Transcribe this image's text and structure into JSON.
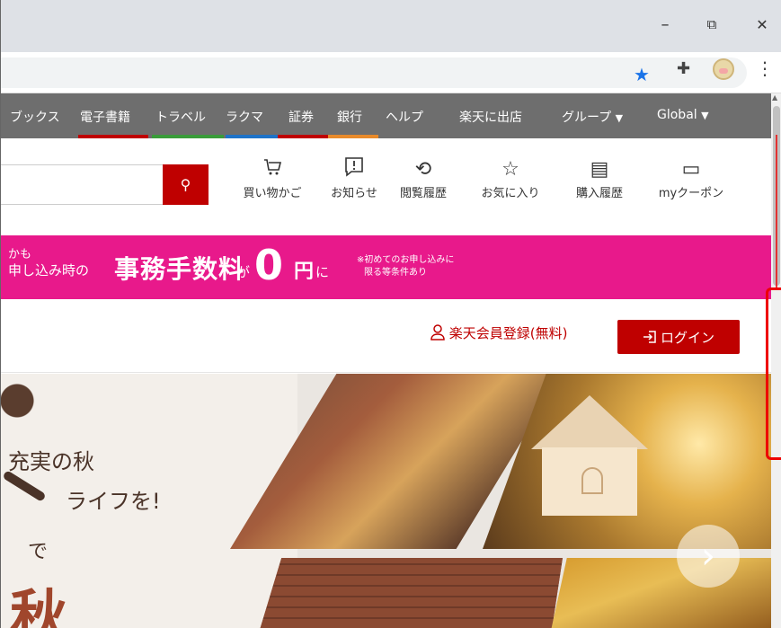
{
  "window": {
    "minimize": "–",
    "restore": "⧉",
    "close": "✕"
  },
  "toolbar": {
    "star": "★",
    "extensions": "✚",
    "menu": "⋮"
  },
  "nav": {
    "items": [
      "ブックス",
      "電子書籍",
      "トラベル",
      "ラクマ",
      "証券",
      "銀行",
      "ヘルプ",
      "楽天に出店",
      "グループ",
      "Global"
    ],
    "chevron": "▼",
    "line_colors": [
      "#bf0000",
      "#3a9c3a",
      "#1e73c8",
      "#bf0000",
      "#e88a2a"
    ]
  },
  "search": {
    "button_icon": "⚲"
  },
  "tools": [
    {
      "icon": "cart-icon",
      "glyph": "🛒",
      "label": "買い物かご"
    },
    {
      "icon": "notification-icon",
      "glyph": "❕",
      "label": "お知らせ"
    },
    {
      "icon": "history-icon",
      "glyph": "⟲",
      "label": "閲覧履歴"
    },
    {
      "icon": "star-icon",
      "glyph": "☆",
      "label": "お気に入り"
    },
    {
      "icon": "purchase-history-icon",
      "glyph": "▤",
      "label": "購入履歴"
    },
    {
      "icon": "coupon-icon",
      "glyph": "▭",
      "label": "myクーポン"
    }
  ],
  "banner": {
    "line1": "かも",
    "line2": "申し込み時の",
    "main": "事務手数料",
    "ga": "が",
    "zero": "0",
    "yen": "円",
    "ni": "に",
    "note1": "※初めてのお申し込みに",
    "note2": "限る等条件あり",
    "color": "#e8198b"
  },
  "member": {
    "register": "楽天会員登録(無料)",
    "login": "ログイン"
  },
  "hero": {
    "copy1": "充実の秋",
    "copy2": "ライフを!",
    "copy3": "で",
    "copy4": "秋",
    "next": "›"
  }
}
